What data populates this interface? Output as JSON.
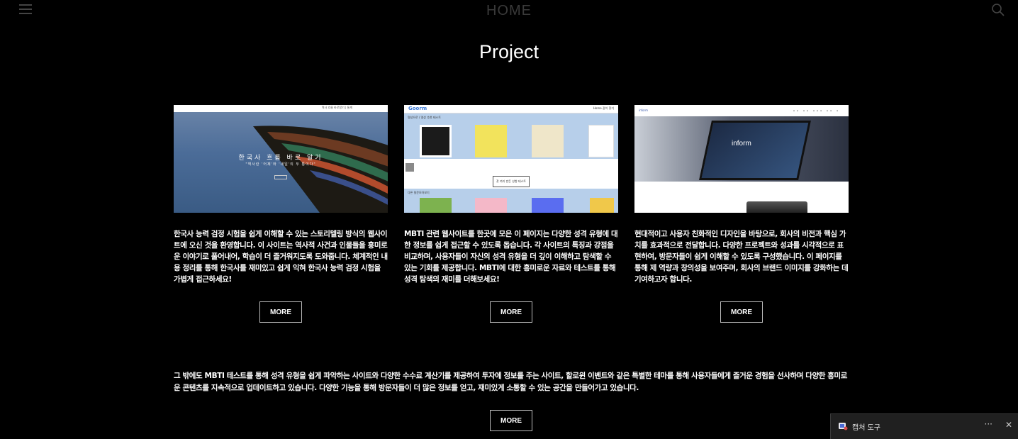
{
  "nav": {
    "title": "HOME",
    "menu_icon": "hamburger-icon",
    "search_icon": "search-icon"
  },
  "section": {
    "title": "Project"
  },
  "cards": [
    {
      "image_title": "한국사 흐름 바로 알기",
      "image_subtitle": "\"역사란 '어제'와 '내일'의 두 통이다\"",
      "image_topbar": "역사 흐름 바로알기 | 통계",
      "description": "한국사 능력 검정 시험을 쉽게 이해할 수 있는 스토리텔링 방식의 웹사이트에 오신 것을 환영합니다. 이 사이트는 역사적 사건과 인물들을 흥미로운 이야기로 풀어내어, 학습이 더 즐거워지도록 도와줍니다. 체계적인 내용 정리를 통해 한국사를 재미있고 쉽게 익혀 한국사 능력 검정 시험을 가볍게 접근하세요!",
      "more": "MORE"
    },
    {
      "image_logo": "Goorm",
      "image_nav": "Home   같이   찾기",
      "image_band1": "명성으로 / 영상 추천 테스트",
      "image_button": "찾 끼리 만든 성향 테스트",
      "image_band2": "다른 질문모아보기",
      "description": "MBTI 관련 웹사이트를 한곳에 모은 이 페이지는 다양한 성격 유형에 대한 정보를 쉽게 접근할 수 있도록 돕습니다. 각 사이트의 특징과 강점을 비교하며, 사용자들이 자신의 성격 유형을 더 깊이 이해하고 탐색할 수 있는 기회를 제공합니다.  MBTI에 대한 흥미로운 자료와 테스트를 통해 성격 탐색의 재미를 더해보세요!",
      "more": "MORE"
    },
    {
      "image_logo": "inform",
      "image_hero_text": "inform",
      "description": " 현대적이고 사용자 친화적인 디자인을 바탕으로, 회사의 비전과 핵심 가치를 효과적으로 전달합니다. 다양한 프로젝트와 성과를 시각적으로 표현하여, 방문자들이 쉽게 이해할 수 있도록 구성했습니다. 이 페이지를 통해 제 역량과 창의성을 보여주며, 회사의 브랜드 이미지를 강화하는 데 기여하고자 합니다.",
      "more": "MORE"
    }
  ],
  "extra": {
    "description": "그 밖에도 MBTI 테스트를 통해 성격 유형을 쉽게 파악하는 사이트와 다양한 수수료 계산기를 제공하여 투자에 정보를 주는 사이트, 할로윈 이벤트와 같은 특별한 테마를 통해 사용자들에게 즐거운 경험을 선사하며 다양한 흥미로운 콘텐츠를 지속적으로 업데이트하고 있습니다. 다양한 기능을 통해 방문자들이 더 많은 정보를 얻고, 재미있게 소통할 수 있는 공간을 만들어가고 있습니다.",
    "more": "MORE"
  },
  "snip_popup": {
    "label": "캡처 도구",
    "dots": "···",
    "close": "✕"
  }
}
